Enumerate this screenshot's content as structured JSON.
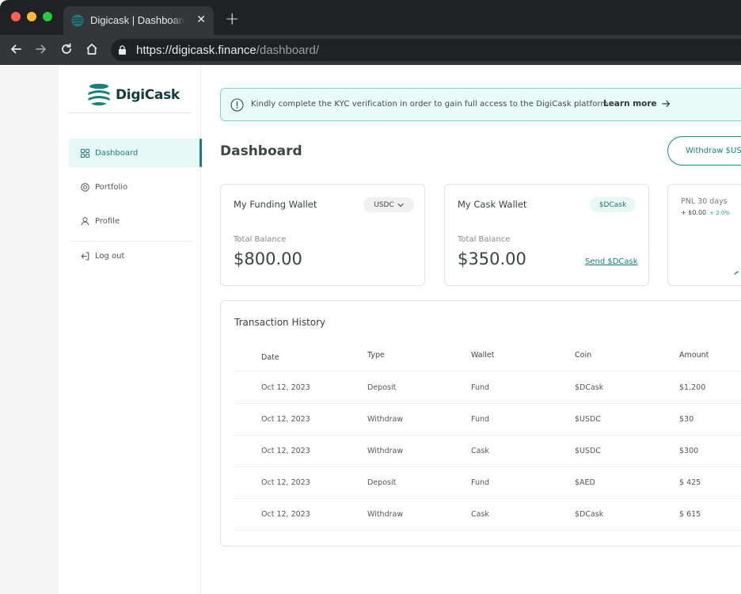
{
  "browser": {
    "tab_title": "Digicask | Dashboard",
    "tab_close": "✕",
    "new_tab": "+",
    "url_host": "https://digicask.finance",
    "url_path": "/dashboard/"
  },
  "brand": {
    "name": "DigiCask",
    "color": "#17807a"
  },
  "sidebar": {
    "items": [
      {
        "label": "Dashboard",
        "icon": "grid-icon",
        "active": true
      },
      {
        "label": "Portfolio",
        "icon": "target-icon",
        "active": false
      },
      {
        "label": "Profile",
        "icon": "user-icon",
        "active": false
      },
      {
        "label": "Log out",
        "icon": "logout-icon",
        "active": false
      }
    ]
  },
  "kyc_banner": {
    "message": "Kindly complete the KYC verification in order to gain full access to the DigiCask platform",
    "link": "Learn more"
  },
  "header": {
    "title": "Dashboard",
    "withdraw_label": "Withdraw $USDC"
  },
  "funding_wallet": {
    "title": "My Funding Wallet",
    "currency": "USDC",
    "balance_label": "Total Balance",
    "balance": "$800.00"
  },
  "cask_wallet": {
    "title": "My Cask Wallet",
    "currency": "$DCask",
    "balance_label": "Total Balance",
    "balance": "$350.00",
    "send_link": "Send $DCask"
  },
  "pnl": {
    "title": "PNL 30 days",
    "value": "+ $0.00",
    "change": "+ 2.0%"
  },
  "transactions": {
    "title": "Transaction History",
    "columns": [
      "Date",
      "Type",
      "Wallet",
      "Coin",
      "Amount"
    ],
    "rows": [
      [
        "Oct 12, 2023",
        "Deposit",
        "Fund",
        "$DCask",
        "$1,200"
      ],
      [
        "Oct 12, 2023",
        "Withdraw",
        "Fund",
        "$USDC",
        "$30"
      ],
      [
        "Oct 12, 2023",
        "Withdraw",
        "Cask",
        "$USDC",
        "$300"
      ],
      [
        "Oct 12, 2023",
        "Deposit",
        "Fund",
        "$AED",
        "$ 425"
      ],
      [
        "Oct 12, 2023",
        "Withdraw",
        "Cask",
        "$DCask",
        "$ 615"
      ]
    ]
  }
}
